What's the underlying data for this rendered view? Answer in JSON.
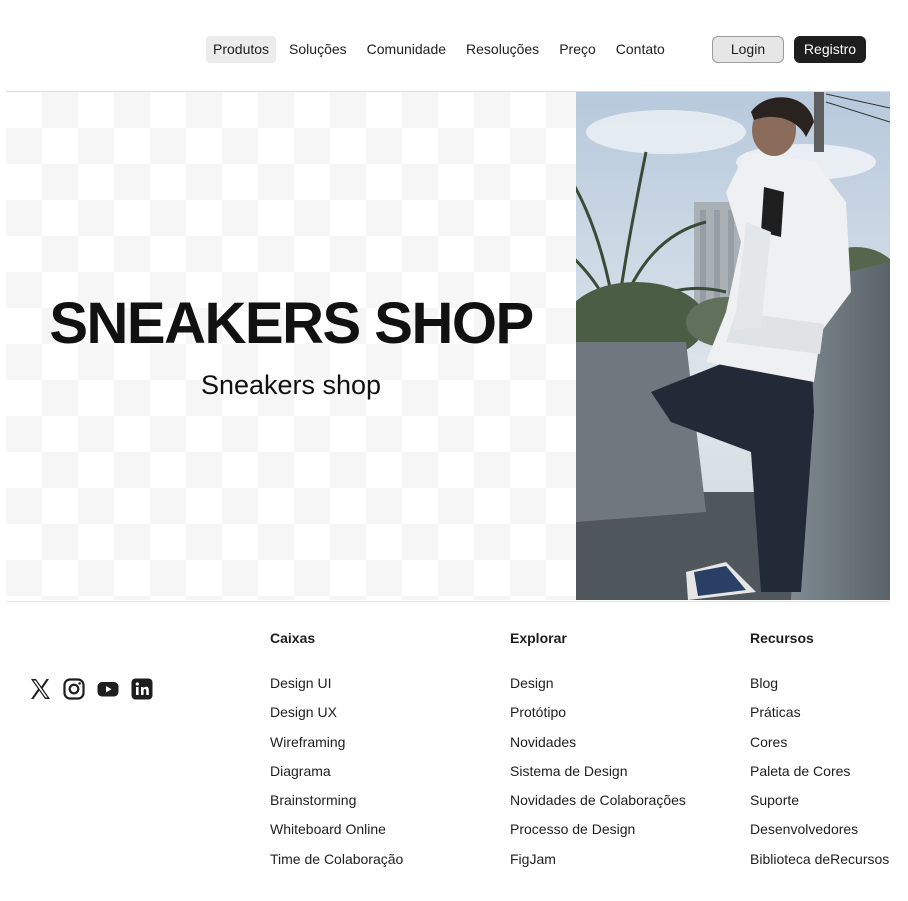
{
  "header": {
    "nav": [
      "Produtos",
      "Soluções",
      "Comunidade",
      "Resoluções",
      "Preço",
      "Contato"
    ],
    "login_label": "Login",
    "register_label": "Registro"
  },
  "hero": {
    "title": "SNEAKERS SHOP",
    "subtitle": "Sneakers shop"
  },
  "footer": {
    "socials": [
      "x-icon",
      "instagram-icon",
      "youtube-icon",
      "linkedin-icon"
    ],
    "columns": [
      {
        "title": "Caixas",
        "links": [
          "Design UI",
          "Design UX",
          "Wireframing",
          "Diagrama",
          "Brainstorming",
          "Whiteboard Online",
          "Time de Colaboração"
        ]
      },
      {
        "title": "Explorar",
        "links": [
          "Design",
          "Protótipo",
          "Novidades",
          "Sistema de Design",
          "Novidades de Colaborações",
          "Processo de Design",
          "FigJam"
        ]
      },
      {
        "title": "Recursos",
        "links": [
          "Blog",
          "Práticas",
          "Cores",
          "Paleta de Cores",
          "Suporte",
          "Desenvolvedores",
          "Biblioteca deRecursos"
        ]
      }
    ]
  }
}
